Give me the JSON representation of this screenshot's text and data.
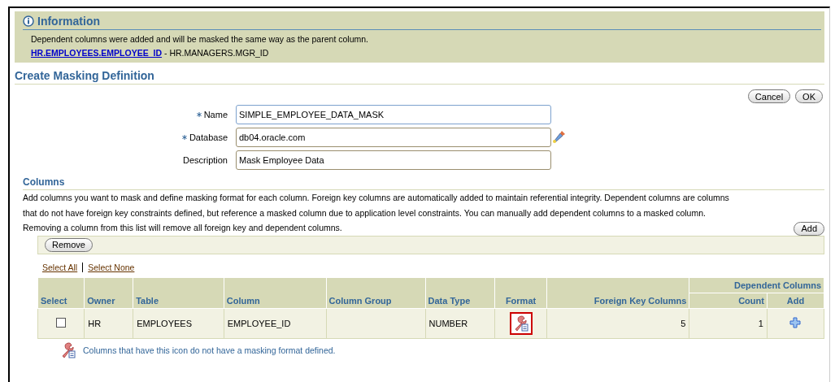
{
  "information": {
    "title": "Information",
    "message": "Dependent columns were added and will be masked the same way as the parent column.",
    "link": "HR.EMPLOYEES.EMPLOYEE_ID",
    "link_suffix": "- HR.MANAGERS.MGR_ID"
  },
  "page_title": "Create Masking Definition",
  "page_buttons": [
    "Cancel",
    "OK"
  ],
  "form": [
    {
      "label": "Name",
      "required": true,
      "value": "SIMPLE_EMPLOYEE_DATA_MASK",
      "focused": true,
      "search_icon": false
    },
    {
      "label": "Database",
      "required": true,
      "value": "db04.oracle.com",
      "focused": false,
      "search_icon": true
    },
    {
      "label": "Description",
      "required": false,
      "value": "Mask Employee Data",
      "focused": false,
      "search_icon": false
    }
  ],
  "columns_section": {
    "title": "Columns",
    "description": [
      "Add columns you want to mask and define masking format for each column. Foreign key columns are automatically added to maintain referential integrity. Dependent columns are columns",
      "that do not have foreign key constraints defined, but reference a masked column due to application level constraints. You can manually add dependent columns to a masked column.",
      "Removing a column from this list will remove all foreign key and dependent columns."
    ],
    "add_button": "Add",
    "remove_button": "Remove",
    "select_all": "Select All",
    "select_none": "Select None"
  },
  "table": {
    "group_header": "Dependent Columns",
    "columns": [
      "Select",
      "Owner",
      "Table",
      "Column",
      "Column Group",
      "Data Type",
      "Format",
      "Foreign Key Columns",
      "Count",
      "Add"
    ],
    "rows": [
      {
        "checked": false,
        "owner": "HR",
        "table": "EMPLOYEES",
        "column": "EMPLOYEE_ID",
        "column_group": "",
        "data_type": "NUMBER",
        "format_defined": false,
        "foreign_key_columns": "5",
        "count": "1"
      }
    ]
  },
  "legend": "Columns that have this icon do not have a masking format defined."
}
